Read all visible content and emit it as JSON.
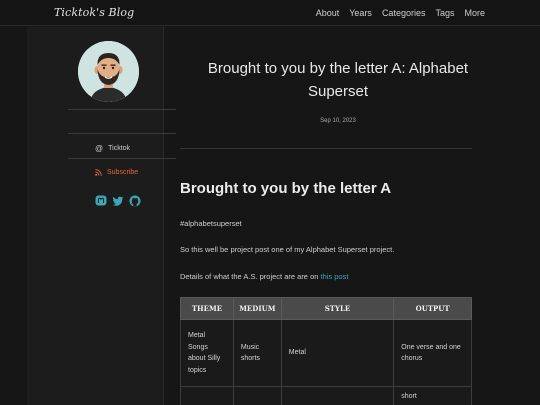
{
  "header": {
    "brand": "Ticktok's Blog",
    "nav": [
      "About",
      "Years",
      "Categories",
      "Tags",
      "More"
    ]
  },
  "sidebar": {
    "handle_icon": "at-icon",
    "handle": "Ticktok",
    "subscribe_icon": "rss-icon",
    "subscribe": "Subscribe",
    "socials": [
      "mastodon-icon",
      "twitter-icon",
      "github-icon"
    ],
    "accent_color": "#e0683a",
    "social_color": "#3aa6b8"
  },
  "post": {
    "title": "Brought to you by the letter A: Alphabet Superset",
    "date": "Sep 10, 2023",
    "heading": "Brought to you by the letter A",
    "tag": "#alphabetsuperset",
    "intro": "So this well be project post one of my Alphabet Superset project.",
    "details_prefix": "Details of what the A.S. project are are on ",
    "details_link": "this post"
  },
  "table": {
    "headers": [
      "THEME",
      "MEDIUM",
      "STYLE",
      "OUTPUT"
    ],
    "rows": [
      [
        "Metal Songs about Silly topics",
        "Music shorts",
        "Metal",
        "One verse and one chorus"
      ],
      [
        "",
        "",
        "",
        "short"
      ]
    ]
  }
}
